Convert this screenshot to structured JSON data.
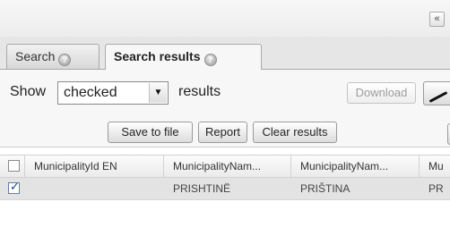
{
  "topbar": {
    "collapse_glyph": "«",
    "collapse_icon": "double-chevron-left-icon"
  },
  "tabs": [
    {
      "label": "Search",
      "active": false,
      "icon": "help-icon"
    },
    {
      "label": "Search results",
      "active": true,
      "icon": "help-icon"
    }
  ],
  "toolbar": {
    "show_label": "Show",
    "filter_value": "checked",
    "results_label": "results",
    "download_label": "Download",
    "download_enabled": false,
    "pen_icon": "pen-icon",
    "save_label": "Save to file",
    "report_label": "Report",
    "clear_label": "Clear results"
  },
  "grid": {
    "columns": [
      "",
      "MunicipalityId EN",
      "MunicipalityNam...",
      "MunicipalityNam...",
      "Mu"
    ],
    "rows": [
      {
        "checked": true,
        "cells": [
          "",
          "PRISHTINË",
          "PRIŠTINA",
          "PR"
        ]
      }
    ]
  },
  "colors": {
    "selected_row": "#e3e3e3",
    "tab_active": "#f7f7f7",
    "checkbox_mark": "#1c3f8f"
  }
}
